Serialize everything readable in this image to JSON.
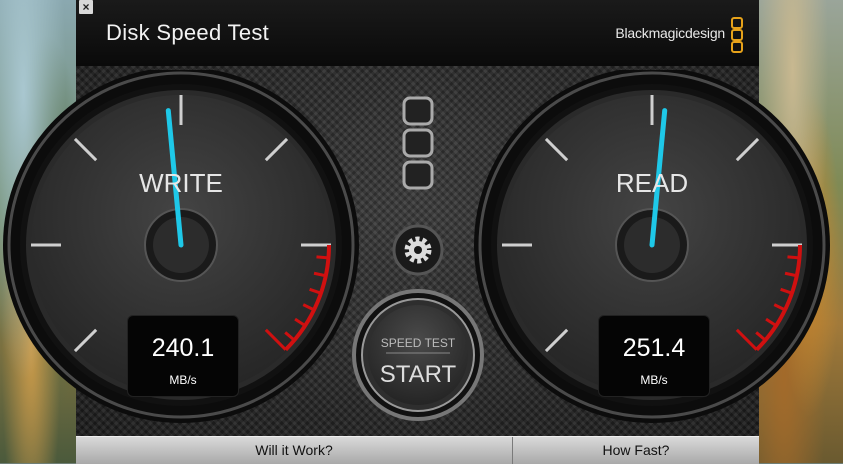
{
  "window": {
    "title": "Disk Speed Test",
    "brand": "Blackmagicdesign",
    "close_glyph": "×"
  },
  "gauges": {
    "write": {
      "label": "WRITE",
      "value": "240.1",
      "unit": "MB/s",
      "fraction": 0.48
    },
    "read": {
      "label": "READ",
      "value": "251.4",
      "unit": "MB/s",
      "fraction": 0.52
    }
  },
  "controls": {
    "icons": [
      "stack-icon",
      "gear-icon"
    ],
    "start_top": "SPEED TEST",
    "start_bottom": "START"
  },
  "tabs": {
    "will_it_work": "Will it Work?",
    "how_fast": "How Fast?"
  },
  "colors": {
    "needle": "#1ec8e8",
    "redline": "#d01010",
    "accent": "#e6a21a"
  }
}
